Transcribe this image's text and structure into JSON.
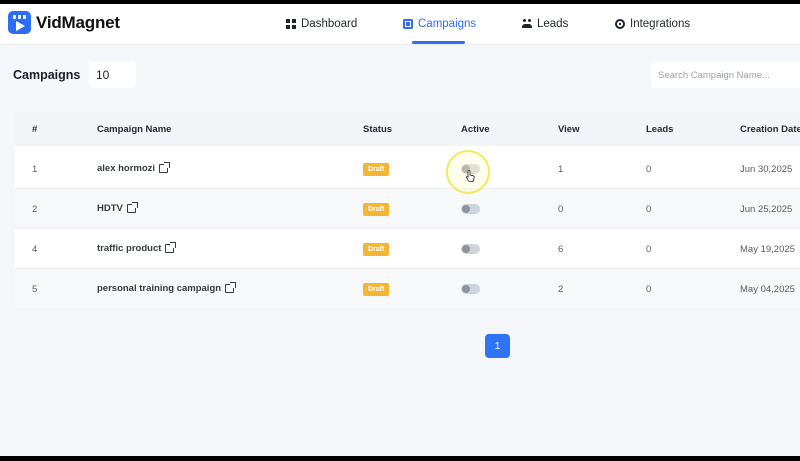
{
  "app": {
    "name": "VidMagnet",
    "brand_color": "#2d6df6"
  },
  "nav": {
    "items": [
      {
        "label": "Dashboard",
        "icon": "grid-icon"
      },
      {
        "label": "Campaigns",
        "icon": "campaign-icon",
        "active": true
      },
      {
        "label": "Leads",
        "icon": "users-icon"
      },
      {
        "label": "Integrations",
        "icon": "integration-icon"
      }
    ]
  },
  "toolbar": {
    "title": "Campaigns",
    "page_size": "10",
    "search_placeholder": "Search Campaign Name..."
  },
  "table": {
    "columns": [
      "#",
      "Campaign Name",
      "Status",
      "Active",
      "View",
      "Leads",
      "Creation Date"
    ],
    "rows": [
      {
        "id": "1",
        "name": "alex hormozi",
        "status": "Draft",
        "active": false,
        "views": "1",
        "leads": "0",
        "created": "Jun 30,2025"
      },
      {
        "id": "2",
        "name": "HDTV",
        "status": "Draft",
        "active": false,
        "views": "0",
        "leads": "0",
        "created": "Jun 25,2025"
      },
      {
        "id": "4",
        "name": "traffic product",
        "status": "Draft",
        "active": false,
        "views": "6",
        "leads": "0",
        "created": "May 19,2025"
      },
      {
        "id": "5",
        "name": "personal training campaign",
        "status": "Draft",
        "active": false,
        "views": "2",
        "leads": "0",
        "created": "May 04,2025"
      }
    ]
  },
  "pagination": {
    "current": "1"
  },
  "colors": {
    "accent": "#2e6ff0",
    "draft_badge": "#f2b632"
  }
}
